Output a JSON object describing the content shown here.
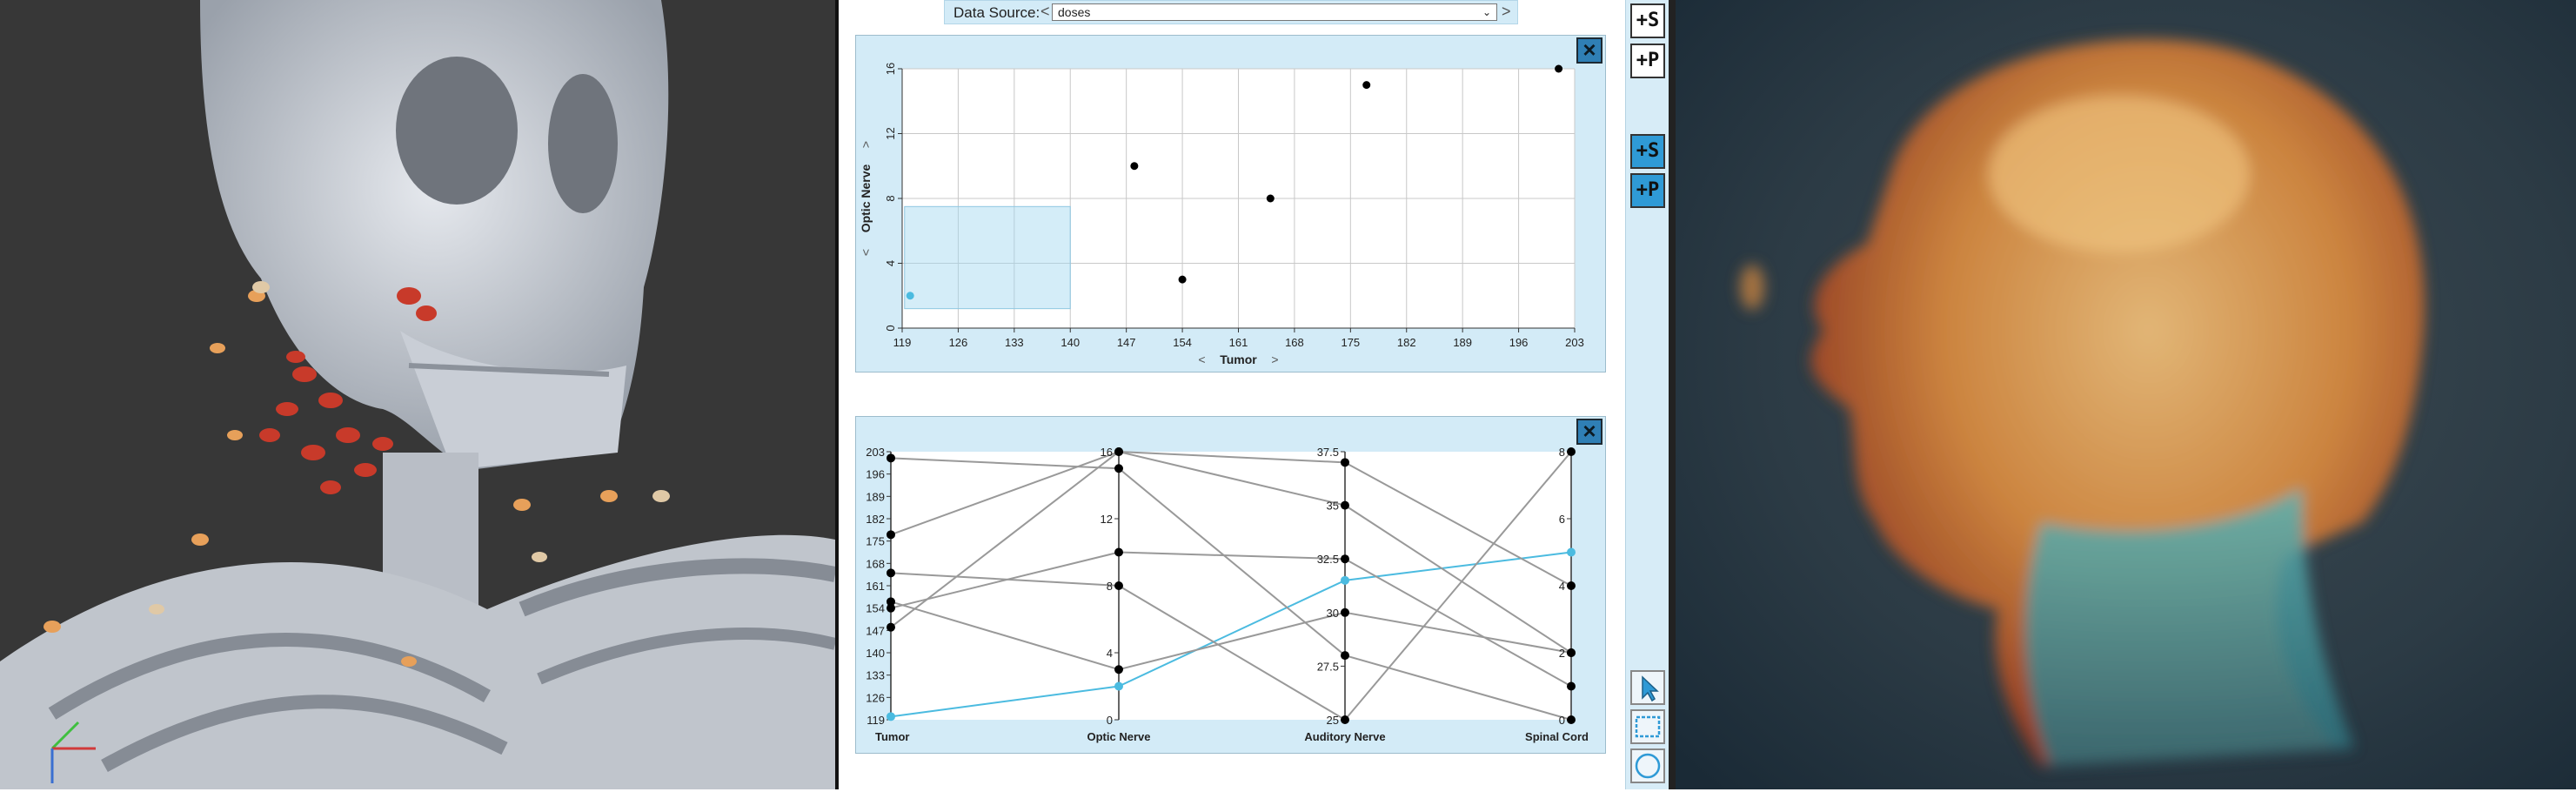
{
  "data_source": {
    "label": "Data Source:",
    "value": "doses",
    "prev_arrow": "<",
    "next_arrow": ">"
  },
  "scatter_panel": {
    "close_icon": "×"
  },
  "parallel_panel": {
    "close_icon": "×"
  },
  "toolbar": {
    "add_scatter_label": "+S",
    "add_parallel_label": "+P",
    "add_scatter_active_label": "+S",
    "add_parallel_active_label": "+P",
    "tools": [
      "pointer-tool-icon",
      "rect-select-tool-icon",
      "circle-select-tool-icon"
    ]
  },
  "colors": {
    "panel_bg": "#d3ebf7",
    "selected": "#4bbbe0",
    "point": "#000000",
    "accent": "#2f9ad6"
  },
  "chart_data": [
    {
      "type": "scatter",
      "xlabel": "Tumor",
      "ylabel": "Optic Nerve",
      "xlim": [
        119,
        203
      ],
      "ylim": [
        0,
        16
      ],
      "x_ticks": [
        119,
        126,
        133,
        140,
        147,
        154,
        161,
        168,
        175,
        182,
        189,
        196,
        203
      ],
      "y_ticks": [
        0,
        4,
        8,
        12,
        16
      ],
      "points": [
        {
          "x": 120,
          "y": 2,
          "selected": true
        },
        {
          "x": 148,
          "y": 10,
          "selected": false
        },
        {
          "x": 154,
          "y": 3,
          "selected": false
        },
        {
          "x": 165,
          "y": 8,
          "selected": false
        },
        {
          "x": 177,
          "y": 15,
          "selected": false
        },
        {
          "x": 201,
          "y": 16,
          "selected": false
        }
      ],
      "brush": {
        "x": [
          119.3,
          140
        ],
        "y": [
          1.2,
          7.5
        ]
      },
      "grid": true
    },
    {
      "type": "parallel_coordinates",
      "axes": [
        {
          "name": "Tumor",
          "range": [
            119,
            203
          ],
          "ticks": [
            119,
            126,
            133,
            140,
            147,
            154,
            161,
            168,
            175,
            182,
            189,
            196,
            203
          ]
        },
        {
          "name": "Optic Nerve",
          "range": [
            0,
            16
          ],
          "ticks": [
            0,
            4,
            8,
            12,
            16
          ]
        },
        {
          "name": "Auditory Nerve",
          "range": [
            25,
            37.5
          ],
          "ticks": [
            25,
            27.5,
            30,
            32.5,
            35,
            37.5
          ]
        },
        {
          "name": "Spinal Cord",
          "range": [
            0,
            8
          ],
          "ticks": [
            0,
            2,
            4,
            6,
            8
          ]
        }
      ],
      "lines": [
        {
          "values": [
            120,
            2,
            31.5,
            5
          ],
          "selected": true
        },
        {
          "values": [
            154,
            10,
            32.5,
            1
          ]
        },
        {
          "values": [
            148,
            16,
            37,
            4
          ]
        },
        {
          "values": [
            201,
            15,
            28,
            0
          ]
        },
        {
          "values": [
            177,
            16,
            35,
            2
          ]
        },
        {
          "values": [
            165,
            8,
            25,
            8
          ]
        },
        {
          "values": [
            156,
            3,
            30,
            2
          ]
        }
      ]
    }
  ]
}
